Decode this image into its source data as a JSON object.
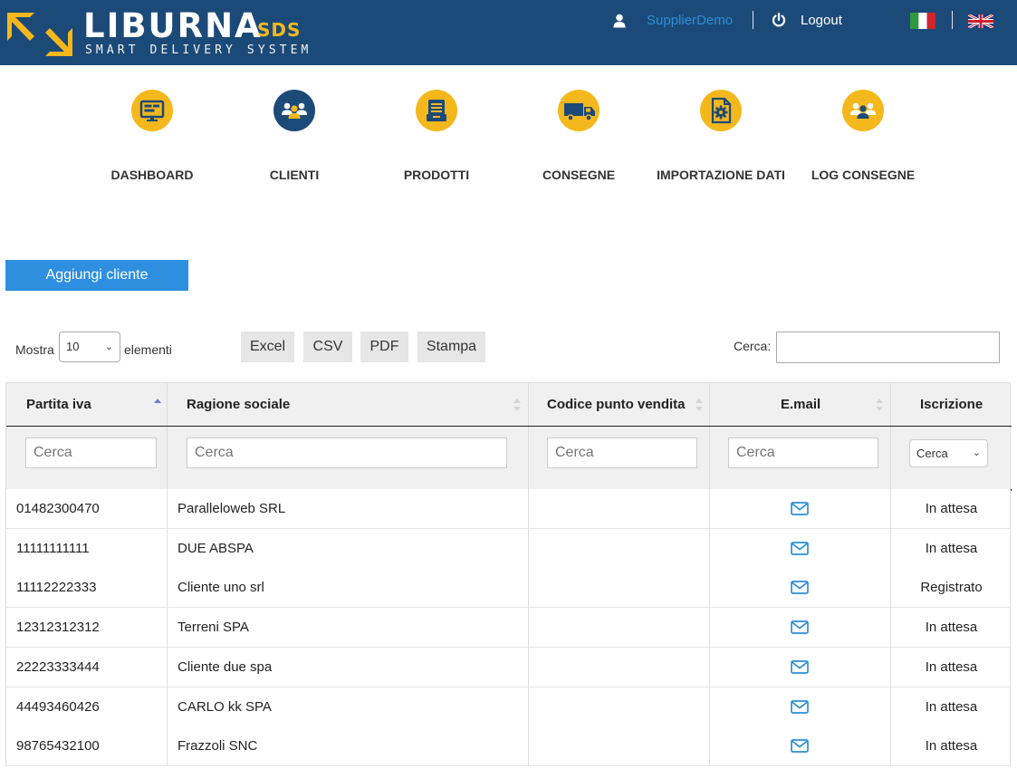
{
  "header": {
    "brand": "LIBURNA",
    "brand_suffix": "SDS",
    "tagline": "SMART DELIVERY SYSTEM",
    "username": "SupplierDemo",
    "logout_label": "Logout",
    "icons": {
      "user": "user-icon",
      "logout": "power-icon",
      "lang_it": "italy-flag-icon",
      "lang_en": "uk-flag-icon"
    },
    "colors": {
      "bar": "#1c4a78",
      "accent": "#f5b81c",
      "link": "#2a8fd6"
    }
  },
  "nav": {
    "items": [
      {
        "label": "DASHBOARD",
        "icon": "dashboard-icon",
        "color": "#f5b81c"
      },
      {
        "label": "CLIENTI",
        "icon": "clients-icon",
        "color": "#1c4a78"
      },
      {
        "label": "PRODOTTI",
        "icon": "products-icon",
        "color": "#f5b81c"
      },
      {
        "label": "CONSEGNE",
        "icon": "truck-icon",
        "color": "#f5b81c"
      },
      {
        "label": "IMPORTAZIONE DATI",
        "icon": "import-gear-icon",
        "color": "#f5b81c"
      },
      {
        "label": "LOG CONSEGNE",
        "icon": "log-users-icon",
        "color": "#f5b81c"
      }
    ]
  },
  "actions": {
    "add_client_label": "Aggiungi cliente"
  },
  "controls": {
    "show_label": "Mostra",
    "page_length": "10",
    "elements_label": "elementi",
    "export_buttons": [
      "Excel",
      "CSV",
      "PDF",
      "Stampa"
    ],
    "search_label": "Cerca:",
    "search_value": ""
  },
  "table": {
    "columns": [
      "Partita iva",
      "Ragione sociale",
      "Codice punto vendita",
      "E.mail",
      "Iscrizione"
    ],
    "sorted_column": "Partita iva",
    "sort_direction": "ascending",
    "filter_placeholder": "Cerca",
    "status_filter_value": "Cerca",
    "rows": [
      {
        "piva": "01482300470",
        "ragione": "Paralleloweb SRL",
        "codice": "",
        "email_icon": "envelope-icon",
        "stato": "In attesa"
      },
      {
        "piva": "11111111111",
        "ragione": "DUE ABSPA",
        "codice": "",
        "email_icon": "envelope-icon",
        "stato": "In attesa"
      },
      {
        "piva": "11112222333",
        "ragione": "Cliente uno srl",
        "codice": "",
        "email_icon": "envelope-icon",
        "stato": "Registrato"
      },
      {
        "piva": "12312312312",
        "ragione": "Terreni SPA",
        "codice": "",
        "email_icon": "envelope-icon",
        "stato": "In attesa"
      },
      {
        "piva": "22223333444",
        "ragione": "Cliente due spa",
        "codice": "",
        "email_icon": "envelope-icon",
        "stato": "In attesa"
      },
      {
        "piva": "44493460426",
        "ragione": "CARLO kk SPA",
        "codice": "",
        "email_icon": "envelope-icon",
        "stato": "In attesa"
      },
      {
        "piva": "98765432100",
        "ragione": "Frazzoli SNC",
        "codice": "",
        "email_icon": "envelope-icon",
        "stato": "In attesa"
      }
    ]
  }
}
